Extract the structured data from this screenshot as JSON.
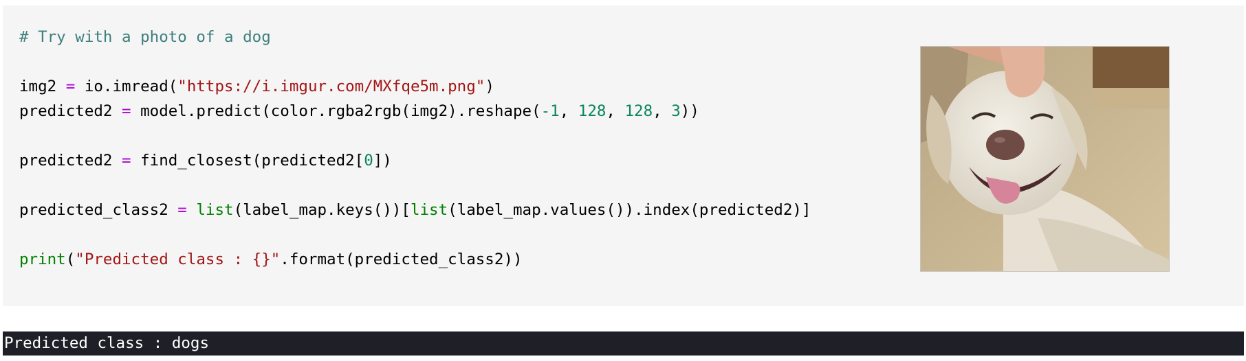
{
  "code_cell": {
    "lines": [
      [
        {
          "t": "# Try with a photo of a dog",
          "c": "comment"
        }
      ],
      [],
      [
        {
          "t": "img2 ",
          "c": "plain"
        },
        {
          "t": "=",
          "c": "op"
        },
        {
          "t": " io.imread(",
          "c": "plain"
        },
        {
          "t": "\"https://i.imgur.com/MXfqe5m.png\"",
          "c": "string"
        },
        {
          "t": ")",
          "c": "plain"
        }
      ],
      [
        {
          "t": "predicted2 ",
          "c": "plain"
        },
        {
          "t": "=",
          "c": "op"
        },
        {
          "t": " model.predict(color.rgba2rgb(img2).reshape(",
          "c": "plain"
        },
        {
          "t": "-1",
          "c": "number"
        },
        {
          "t": ", ",
          "c": "plain"
        },
        {
          "t": "128",
          "c": "number"
        },
        {
          "t": ", ",
          "c": "plain"
        },
        {
          "t": "128",
          "c": "number"
        },
        {
          "t": ", ",
          "c": "plain"
        },
        {
          "t": "3",
          "c": "number"
        },
        {
          "t": "))",
          "c": "plain"
        }
      ],
      [],
      [
        {
          "t": "predicted2 ",
          "c": "plain"
        },
        {
          "t": "=",
          "c": "op"
        },
        {
          "t": " find_closest(predicted2[",
          "c": "plain"
        },
        {
          "t": "0",
          "c": "number"
        },
        {
          "t": "])",
          "c": "plain"
        }
      ],
      [],
      [
        {
          "t": "predicted_class2 ",
          "c": "plain"
        },
        {
          "t": "=",
          "c": "op"
        },
        {
          "t": " ",
          "c": "plain"
        },
        {
          "t": "list",
          "c": "builtin"
        },
        {
          "t": "(label_map.keys())[",
          "c": "plain"
        },
        {
          "t": "list",
          "c": "builtin"
        },
        {
          "t": "(label_map.values()).index(predicted2)]",
          "c": "plain"
        }
      ],
      [],
      [
        {
          "t": "print",
          "c": "builtin"
        },
        {
          "t": "(",
          "c": "plain"
        },
        {
          "t": "\"Predicted class : {}\"",
          "c": "string"
        },
        {
          "t": ".format(predicted_class2))",
          "c": "plain"
        }
      ]
    ]
  },
  "image": {
    "icon": "dog-photo"
  },
  "output": {
    "text": "Predicted class : dogs"
  }
}
